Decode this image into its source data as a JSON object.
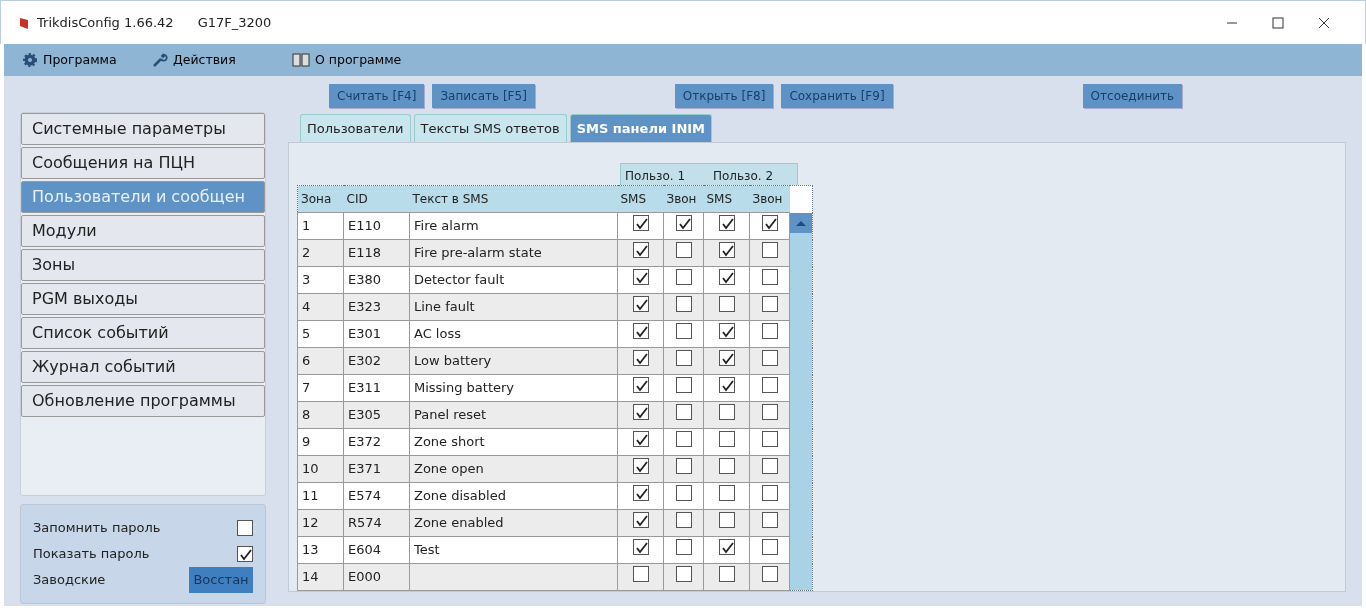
{
  "window": {
    "title": "TrikdisConfig 1.66.42",
    "device": "G17F_3200"
  },
  "menu": [
    {
      "label": "Программа"
    },
    {
      "label": "Действия"
    },
    {
      "label": "О программе"
    }
  ],
  "toolbar": [
    [
      "Считать [F4]",
      "Записать [F5]"
    ],
    [
      "Открыть [F8]",
      "Сохранить [F9]"
    ],
    [
      "Отсоединить"
    ]
  ],
  "sidebar": {
    "items": [
      {
        "label": "Системные параметры",
        "selected": false
      },
      {
        "label": "Сообщения на ПЦН",
        "selected": false
      },
      {
        "label": "Пользователи и сообщен",
        "selected": true
      },
      {
        "label": "Модули",
        "selected": false
      },
      {
        "label": "Зоны",
        "selected": false
      },
      {
        "label": "PGM выходы",
        "selected": false
      },
      {
        "label": "Список событий",
        "selected": false
      },
      {
        "label": "Журнал событий",
        "selected": false
      },
      {
        "label": "Обновление программы",
        "selected": false
      }
    ]
  },
  "options": [
    {
      "label": "Запомнить пароль",
      "checked": false
    },
    {
      "label": "Показать пароль",
      "checked": true
    }
  ],
  "factory": {
    "label": "Заводские",
    "button": "Восстан"
  },
  "tabs": [
    {
      "label": "Пользователи",
      "selected": false
    },
    {
      "label": "Тексты SMS ответов",
      "selected": false
    },
    {
      "label": "SMS панели INIM",
      "selected": true
    }
  ],
  "table": {
    "group_headers": [
      "Пользо. 1",
      "Пользо. 2"
    ],
    "columns": [
      "Зона",
      "CID",
      "Текст в SMS",
      "SMS",
      "Звон",
      "SMS",
      "Звон"
    ],
    "rows": [
      {
        "zone": "1",
        "cid": "E110",
        "text": "Fire alarm",
        "flags": [
          true,
          true,
          true,
          true
        ]
      },
      {
        "zone": "2",
        "cid": "E118",
        "text": "Fire pre-alarm state",
        "flags": [
          true,
          false,
          true,
          false
        ]
      },
      {
        "zone": "3",
        "cid": "E380",
        "text": "Detector fault",
        "flags": [
          true,
          false,
          true,
          false
        ]
      },
      {
        "zone": "4",
        "cid": "E323",
        "text": "Line fault",
        "flags": [
          true,
          false,
          false,
          false
        ]
      },
      {
        "zone": "5",
        "cid": "E301",
        "text": "AC loss",
        "flags": [
          true,
          false,
          true,
          false
        ]
      },
      {
        "zone": "6",
        "cid": "E302",
        "text": "Low battery",
        "flags": [
          true,
          false,
          true,
          false
        ]
      },
      {
        "zone": "7",
        "cid": "E311",
        "text": "Missing battery",
        "flags": [
          true,
          false,
          true,
          false
        ]
      },
      {
        "zone": "8",
        "cid": "E305",
        "text": "Panel reset",
        "flags": [
          true,
          false,
          false,
          false
        ]
      },
      {
        "zone": "9",
        "cid": "E372",
        "text": "Zone short",
        "flags": [
          true,
          false,
          false,
          false
        ]
      },
      {
        "zone": "10",
        "cid": "E371",
        "text": "Zone open",
        "flags": [
          true,
          false,
          false,
          false
        ]
      },
      {
        "zone": "11",
        "cid": "E574",
        "text": "Zone disabled",
        "flags": [
          true,
          false,
          false,
          false
        ]
      },
      {
        "zone": "12",
        "cid": "R574",
        "text": "Zone enabled",
        "flags": [
          true,
          false,
          false,
          false
        ]
      },
      {
        "zone": "13",
        "cid": "E604",
        "text": "Test",
        "flags": [
          true,
          false,
          true,
          false
        ]
      },
      {
        "zone": "14",
        "cid": "E000",
        "flags": [
          false,
          false,
          false,
          false
        ]
      }
    ]
  }
}
